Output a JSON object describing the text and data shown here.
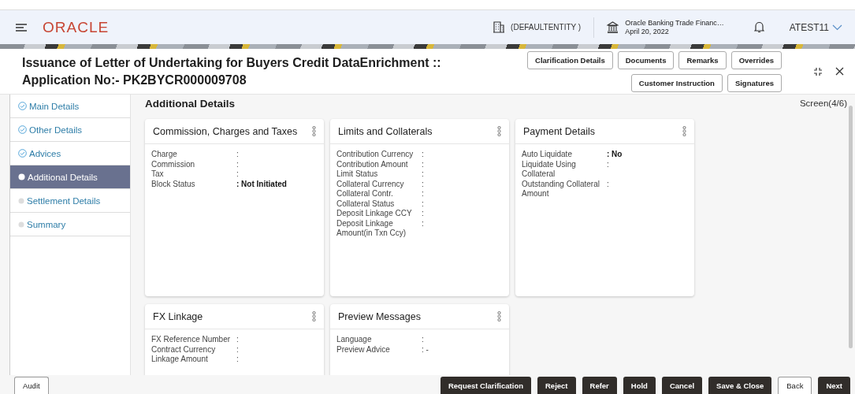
{
  "header": {
    "brand": "ORACLE",
    "entity": "(DEFAULTENTITY )",
    "bank_name": "Oracle Banking Trade Financ…",
    "date": "April 20, 2022",
    "user": "ATEST11"
  },
  "title": {
    "line1": "Issuance of Letter of Undertaking for Buyers Credit DataEnrichment ::",
    "line2": "Application No:- PK2BYCR000009708"
  },
  "top_buttons": [
    [
      "Clarification Details",
      "Documents",
      "Remarks",
      "Overrides"
    ],
    [
      "Customer Instruction",
      "Signatures"
    ]
  ],
  "steps": [
    {
      "label": "Main Details",
      "kind": "done",
      "selected": false
    },
    {
      "label": "Other Details",
      "kind": "done",
      "selected": false
    },
    {
      "label": "Advices",
      "kind": "done",
      "selected": false
    },
    {
      "label": "Additional Details",
      "kind": "current",
      "selected": true
    },
    {
      "label": "Settlement Details",
      "kind": "pending",
      "selected": false
    },
    {
      "label": "Summary",
      "kind": "pending",
      "selected": false
    }
  ],
  "section_title": "Additional Details",
  "screen_indicator": "Screen(4/6)",
  "cards": [
    {
      "title": "Commission, Charges and Taxes",
      "fields": [
        {
          "label": "Charge",
          "value": ":",
          "bold": false
        },
        {
          "label": "Commission",
          "value": ":",
          "bold": false
        },
        {
          "label": "Tax",
          "value": ":",
          "bold": false
        },
        {
          "label": "Block Status",
          "value": ": Not Initiated",
          "bold": true
        }
      ]
    },
    {
      "title": "Limits and Collaterals",
      "fields": [
        {
          "label": "Contribution Currency",
          "value": ":",
          "bold": false
        },
        {
          "label": "Contribution Amount",
          "value": ":",
          "bold": false
        },
        {
          "label": "Limit Status",
          "value": ":",
          "bold": false
        },
        {
          "label": "Collateral Currency",
          "value": ":",
          "bold": false
        },
        {
          "label": "Collateral Contr.",
          "value": ":",
          "bold": false
        },
        {
          "label": "Collateral Status",
          "value": ":",
          "bold": false
        },
        {
          "label": "Deposit Linkage CCY",
          "value": ":",
          "bold": false
        },
        {
          "label": "Deposit Linkage Amount(in Txn Ccy)",
          "value": ":",
          "bold": false
        }
      ]
    },
    {
      "title": "Payment Details",
      "fields": [
        {
          "label": "Auto Liquidate",
          "value": ": No",
          "bold": true
        },
        {
          "label": "Liquidate Using Collateral",
          "value": ":",
          "bold": false
        },
        {
          "label": "Outstanding Collateral Amount",
          "value": ":",
          "bold": false
        }
      ]
    },
    {
      "title": "FX Linkage",
      "fields": [
        {
          "label": "FX Reference Number",
          "value": ":",
          "bold": false
        },
        {
          "label": "Contract Currency",
          "value": ":",
          "bold": false
        },
        {
          "label": "Linkage Amount",
          "value": ":",
          "bold": false
        }
      ]
    },
    {
      "title": "Preview Messages",
      "fields": [
        {
          "label": "Language",
          "value": ":",
          "bold": false
        },
        {
          "label": "Preview Advice",
          "value": ": -",
          "bold": false
        }
      ]
    }
  ],
  "footer": {
    "audit": "Audit",
    "actions": [
      {
        "label": "Request Clarification",
        "kind": "dark"
      },
      {
        "label": "Reject",
        "kind": "dark"
      },
      {
        "label": "Refer",
        "kind": "dark"
      },
      {
        "label": "Hold",
        "kind": "dark"
      },
      {
        "label": "Cancel",
        "kind": "dark"
      },
      {
        "label": "Save & Close",
        "kind": "dark"
      },
      {
        "label": "Back",
        "kind": "light"
      },
      {
        "label": "Next",
        "kind": "dark"
      }
    ]
  }
}
